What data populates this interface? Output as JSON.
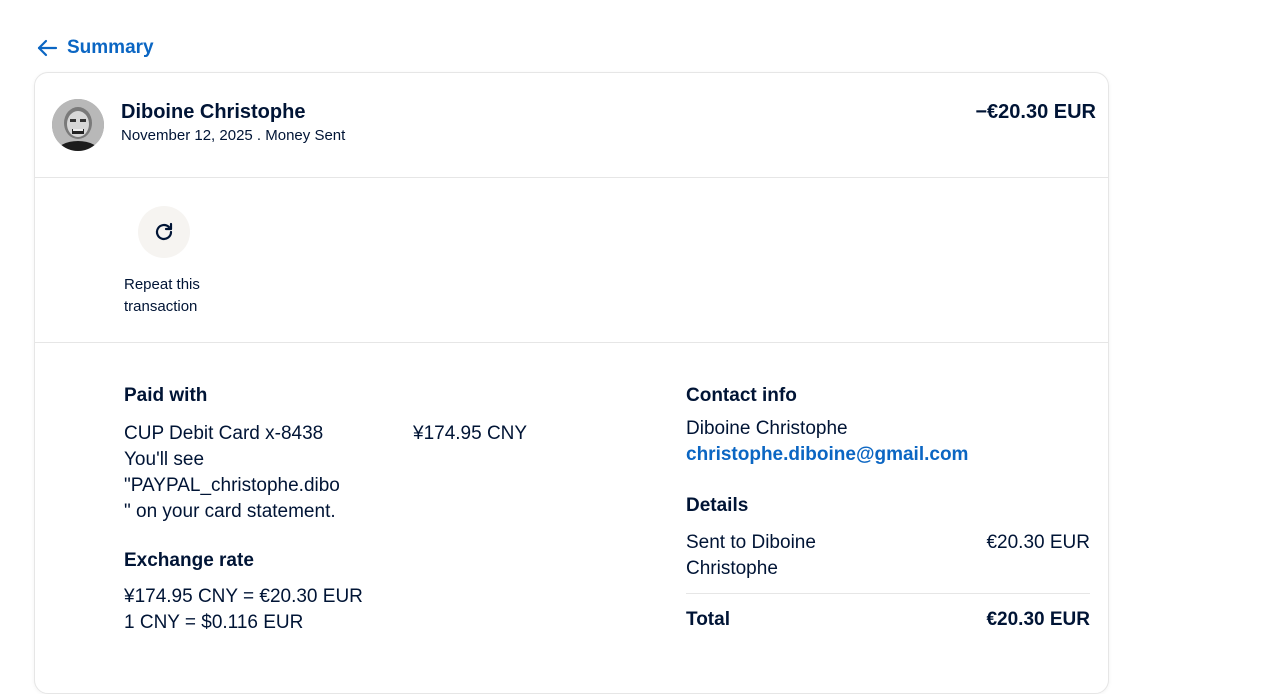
{
  "nav": {
    "back_label": "Summary"
  },
  "header": {
    "name": "Diboine Christophe",
    "subtitle": "November 12, 2025 . Money Sent",
    "amount": "−€20.30 EUR"
  },
  "actions": {
    "repeat_label": "Repeat this transaction"
  },
  "paid_with": {
    "title": "Paid with",
    "method": "CUP Debit Card x-8438",
    "amount": "¥174.95 CNY",
    "statement_line1": "You'll see",
    "statement_line2": "\"PAYPAL_christophe.dibo",
    "statement_line3": "\" on your card statement."
  },
  "exchange": {
    "title": "Exchange rate",
    "line1": "¥174.95 CNY = €20.30 EUR",
    "line2": "1 CNY = $0.116 EUR"
  },
  "contact": {
    "title": "Contact info",
    "name": "Diboine Christophe",
    "email": "christophe.diboine@gmail.com"
  },
  "details": {
    "title": "Details",
    "sent_label_line1": "Sent to Diboine",
    "sent_label_line2": "Christophe",
    "sent_amount": "€20.30 EUR",
    "total_label": "Total",
    "total_amount": "€20.30 EUR"
  },
  "colors": {
    "link": "#0b66c3",
    "text": "#001435"
  },
  "icons": {
    "back": "arrow-left-icon",
    "repeat": "refresh-icon",
    "avatar": "user-photo"
  }
}
